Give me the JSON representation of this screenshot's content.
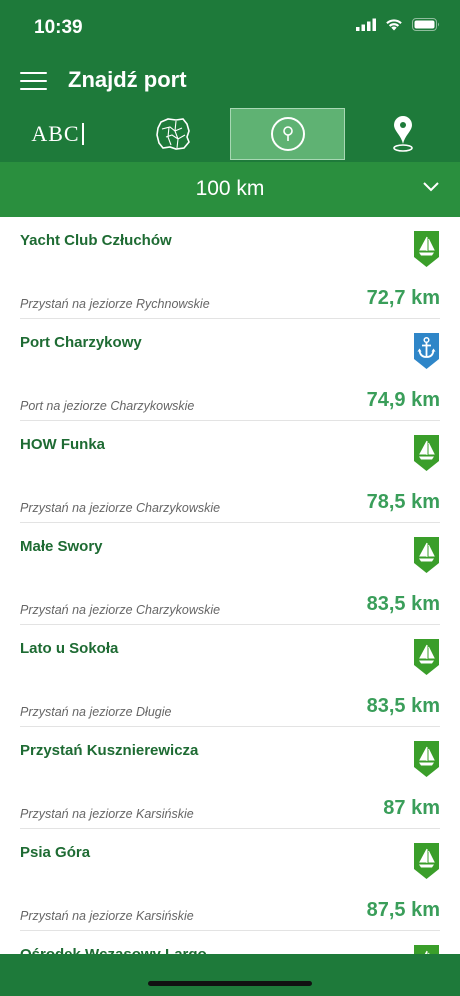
{
  "status": {
    "time": "10:39"
  },
  "header": {
    "title": "Znajdź port"
  },
  "tabs": [
    {
      "label": "ABC",
      "icon": "abc-icon"
    },
    {
      "icon": "map-poland-icon"
    },
    {
      "icon": "location-pin-icon",
      "active": true
    },
    {
      "icon": "map-marker-icon"
    }
  ],
  "filter": {
    "value": "100 km"
  },
  "ports": [
    {
      "name": "Yacht Club Człuchów",
      "description": "Przystań na jeziorze Rychnowskie",
      "distance": "72,7 km",
      "icon": "sailboat-icon",
      "color": "#3a9e2a"
    },
    {
      "name": "Port Charzykowy",
      "description": "Port na jeziorze Charzykowskie",
      "distance": "74,9 km",
      "icon": "anchor-icon",
      "color": "#2f86c8"
    },
    {
      "name": "HOW Funka",
      "description": "Przystań na jeziorze Charzykowskie",
      "distance": "78,5 km",
      "icon": "sailboat-icon",
      "color": "#3a9e2a"
    },
    {
      "name": "Małe Swory",
      "description": "Przystań na jeziorze Charzykowskie",
      "distance": "83,5 km",
      "icon": "sailboat-icon",
      "color": "#3a9e2a"
    },
    {
      "name": "Lato u Sokoła",
      "description": "Przystań na jeziorze Długie",
      "distance": "83,5 km",
      "icon": "sailboat-icon",
      "color": "#3a9e2a"
    },
    {
      "name": "Przystań Kusznierewicza",
      "description": "Przystań na jeziorze Karsińskie",
      "distance": "87 km",
      "icon": "sailboat-icon",
      "color": "#3a9e2a"
    },
    {
      "name": "Psia Góra",
      "description": "Przystań na jeziorze Karsińskie",
      "distance": "87,5 km",
      "icon": "sailboat-icon",
      "color": "#3a9e2a"
    },
    {
      "name": "Ośrodek Wczasowy Largo",
      "description": "",
      "distance": "",
      "icon": "sailboat-icon",
      "color": "#3a9e2a"
    }
  ],
  "colors": {
    "header": "#1e7a3a",
    "filter": "#2a8f3e",
    "accent": "#3a9e5a"
  }
}
